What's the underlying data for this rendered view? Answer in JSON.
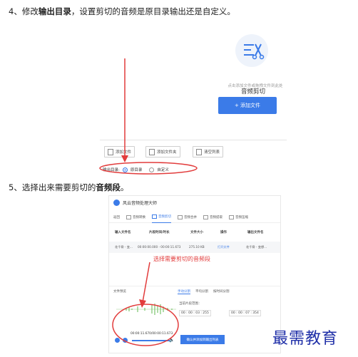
{
  "step4": {
    "prefix": "4、修改",
    "bold": "输出目录",
    "suffix": "，设置剪切的音频是原目录输出还是自定义。"
  },
  "shot1": {
    "tool_name": "音频剪切",
    "hint": "点击添加文件或拖拽文件到此处",
    "add_button": "+ 添加文件",
    "buttons": [
      "添加文件",
      "添加文件夹",
      "清空列表"
    ],
    "output_label": "输出目录:",
    "options": [
      "原目录",
      "自定义"
    ]
  },
  "step5": {
    "prefix": "5、选择出来需要剪切的",
    "bold": "音频段",
    "suffix": "。"
  },
  "shot2": {
    "app_title": "风云音频处理大师",
    "tabs": [
      "返回",
      "音频转换",
      "音频剪切",
      "音频合并",
      "音频提取",
      "音频压缩"
    ],
    "columns": [
      "输入文件名",
      "片段时间/时长",
      "文件大小",
      "操作",
      "输出文件名"
    ],
    "row": [
      "花千骨 - 变...",
      "00:00:00.000 - 00:00:11.673",
      "275.10 KB",
      "打开文件",
      "花千骨 - 变想..."
    ],
    "overlay_hint": "选择需要剪切的音频段",
    "preview_label": "文件预览",
    "subtabs": [
      "手动分割",
      "平均分割",
      "按时间分割"
    ],
    "range_label": "当前片段范围：",
    "start_time": "00 : 00 : 03 : 255",
    "end_time": "00 : 00 : 07 : 354",
    "timecode": "00:00:11.670/00:00:11.673",
    "confirm_button": "确认并添加到输出列表"
  },
  "watermark": "最需教育",
  "colors": {
    "accent": "#3b7be8",
    "annotation": "#e23c3c",
    "watermark": "#1f2fa8"
  }
}
